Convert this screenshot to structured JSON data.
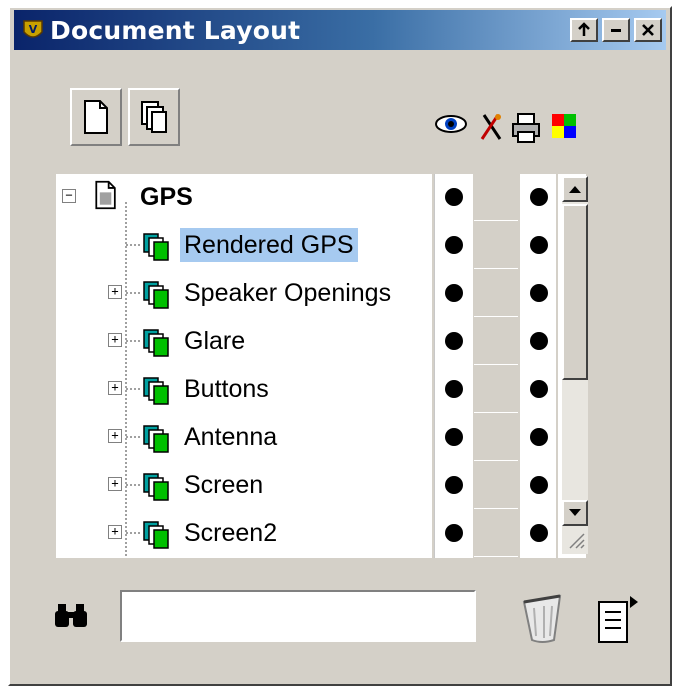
{
  "window": {
    "title": "Document Layout",
    "buttons": {
      "pin": "pin-icon",
      "minimize": "minimize-icon",
      "close": "close-icon"
    }
  },
  "toolbar": {
    "new_document_icon": "new-document-icon",
    "new_layer_icon": "new-layer-icon"
  },
  "column_headers": [
    "eye-icon",
    "lock-icon",
    "printer-icon",
    "color-icon"
  ],
  "tree": {
    "root": {
      "label": "GPS",
      "expanded": true
    },
    "layers": [
      {
        "label": "Rendered GPS",
        "selected": true,
        "expandable": false,
        "visible": true,
        "printable": true
      },
      {
        "label": "Speaker Openings",
        "selected": false,
        "expandable": true,
        "visible": true,
        "printable": true
      },
      {
        "label": "Glare",
        "selected": false,
        "expandable": true,
        "visible": true,
        "printable": true
      },
      {
        "label": "Buttons",
        "selected": false,
        "expandable": true,
        "visible": true,
        "printable": true
      },
      {
        "label": "Antenna",
        "selected": false,
        "expandable": true,
        "visible": true,
        "printable": true
      },
      {
        "label": "Screen",
        "selected": false,
        "expandable": true,
        "visible": true,
        "printable": true
      },
      {
        "label": "Screen2",
        "selected": false,
        "expandable": true,
        "visible": true,
        "printable": true
      }
    ]
  },
  "search": {
    "value": "",
    "placeholder": ""
  },
  "colors": {
    "title_start": "#0a246a",
    "title_end": "#a6caf0",
    "selection": "#a6caf0",
    "layer_teal": "#00a0a0",
    "layer_green": "#00c000"
  }
}
